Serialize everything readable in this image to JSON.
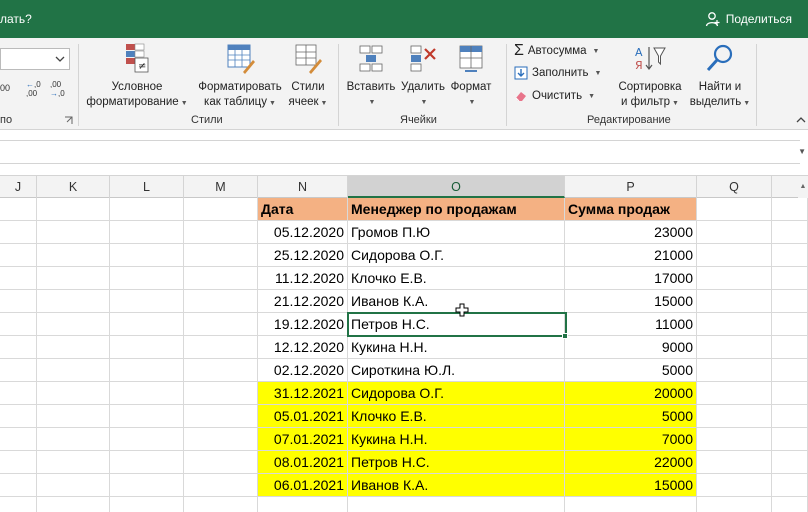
{
  "titlebar": {
    "search_text": "лать?",
    "share_label": "Поделиться"
  },
  "ribbon": {
    "number_fragment_1": "00",
    "number_fragment_2": ",00",
    "number_fragment_3": ",0",
    "number_fragment_4": "по",
    "conditional_format_l1": "Условное",
    "conditional_format_l2": "форматирование",
    "format_table_l1": "Форматировать",
    "format_table_l2": "как таблицу",
    "styles_l1": "Стили",
    "styles_l2": "ячеек",
    "styles_group": "Стили",
    "insert_label": "Вставить",
    "delete_label": "Удалить",
    "format_label": "Формат",
    "cells_group": "Ячейки",
    "autosum_label": "Автосумма",
    "fill_label": "Заполнить",
    "clear_label": "Очистить",
    "sort_l1": "Сортировка",
    "sort_l2": "и фильтр",
    "find_l1": "Найти и",
    "find_l2": "выделить",
    "editing_group": "Редактирование"
  },
  "columns": [
    "J",
    "K",
    "L",
    "M",
    "N",
    "O",
    "P",
    "Q"
  ],
  "table": {
    "headers": [
      "Дата",
      "Менеджер по продажам",
      "Сумма продаж"
    ],
    "rows": [
      [
        "05.12.2020",
        "Громов П.Ю",
        "23000"
      ],
      [
        "25.12.2020",
        "Сидорова  О.Г.",
        "21000"
      ],
      [
        "11.12.2020",
        "Клочко Е.В.",
        "17000"
      ],
      [
        "21.12.2020",
        "Иванов К.А.",
        "15000"
      ],
      [
        "19.12.2020",
        "Петров Н.С.",
        "11000"
      ],
      [
        "12.12.2020",
        "Кукина Н.Н.",
        "9000"
      ],
      [
        "02.12.2020",
        "Сироткина Ю.Л.",
        "5000"
      ],
      [
        "31.12.2021",
        "Сидорова  О.Г.",
        "20000"
      ],
      [
        "05.01.2021",
        "Клочко Е.В.",
        "5000"
      ],
      [
        "07.01.2021",
        "Кукина Н.Н.",
        "7000"
      ],
      [
        "08.01.2021",
        "Петров Н.С.",
        "22000"
      ],
      [
        "06.01.2021",
        "Иванов К.А.",
        "15000"
      ]
    ]
  },
  "colors": {
    "excel_green": "#217346",
    "header_fill": "#f4b183",
    "highlight_fill": "#ffff00"
  },
  "selection": {
    "cell": "O7",
    "highlighted_rows_from": 8
  }
}
